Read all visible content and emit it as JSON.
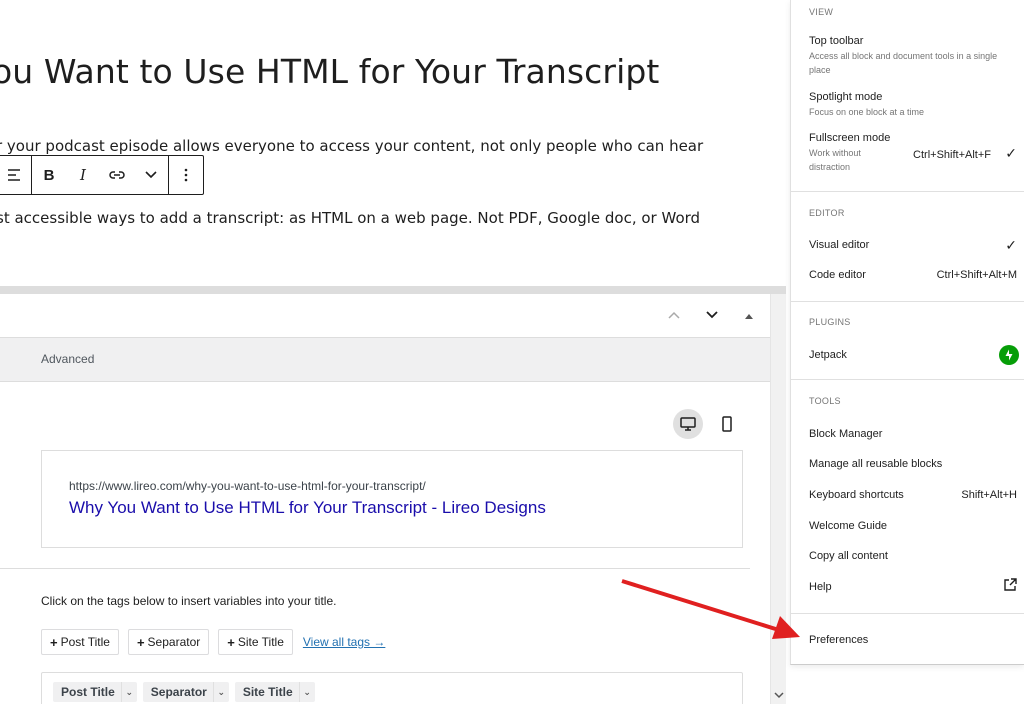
{
  "editor": {
    "title": "ou Want to Use HTML for Your Transcript",
    "paragraph1": "r your podcast episode allows everyone to access your content, not only people who can hear",
    "paragraph2": "st accessible ways to add a transcript: as HTML on a web page. Not PDF, Google doc, or Word",
    "toolbar": {
      "bold": "B",
      "italic": "I"
    }
  },
  "metabox": {
    "tab_advanced": "Advanced",
    "preview": {
      "url": "https://www.lireo.com/why-you-want-to-use-html-for-your-transcript/",
      "title": "Why You Want to Use HTML for Your Transcript - Lireo Designs"
    },
    "help_text": "Click on the tags below to insert variables into your title.",
    "tag_buttons": [
      "Post Title",
      "Separator",
      "Site Title"
    ],
    "view_all": "View all tags →",
    "chips": [
      "Post Title",
      "Separator",
      "Site Title"
    ]
  },
  "menu": {
    "view": {
      "label": "VIEW",
      "items": [
        {
          "label": "Top toolbar",
          "help": "Access all block and document tools in a single place"
        },
        {
          "label": "Spotlight mode",
          "help": "Focus on one block at a time"
        },
        {
          "label": "Fullscreen mode",
          "help": "Work without distraction",
          "shortcut": "Ctrl+Shift+Alt+F",
          "checked": "✓"
        }
      ]
    },
    "editor": {
      "label": "EDITOR",
      "items": [
        {
          "label": "Visual editor",
          "checked": "✓"
        },
        {
          "label": "Code editor",
          "shortcut": "Ctrl+Shift+Alt+M"
        }
      ]
    },
    "plugins": {
      "label": "PLUGINS",
      "items": [
        {
          "label": "Jetpack"
        }
      ]
    },
    "tools": {
      "label": "TOOLS",
      "items": [
        {
          "label": "Block Manager"
        },
        {
          "label": "Manage all reusable blocks"
        },
        {
          "label": "Keyboard shortcuts",
          "shortcut": "Shift+Alt+H"
        },
        {
          "label": "Welcome Guide"
        },
        {
          "label": "Copy all content"
        },
        {
          "label": "Help"
        }
      ]
    },
    "preferences": "Preferences"
  },
  "colors": {
    "link": "#1a0dab",
    "jetpack": "#069e08",
    "arrow": "#e02020"
  }
}
